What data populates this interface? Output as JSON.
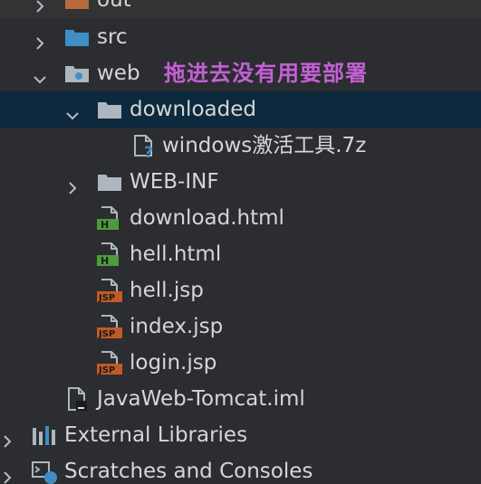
{
  "tree": {
    "rows": [
      {
        "label": "out"
      },
      {
        "label": "src"
      },
      {
        "label": "web",
        "annotation": "拖进去没有用要部署"
      },
      {
        "label": "downloaded"
      },
      {
        "label": "windows激活工具.7z"
      },
      {
        "label": "WEB-INF"
      },
      {
        "label": "download.html"
      },
      {
        "label": "hell.html"
      },
      {
        "label": "hell.jsp"
      },
      {
        "label": "index.jsp"
      },
      {
        "label": "login.jsp"
      },
      {
        "label": "JavaWeb-Tomcat.iml"
      },
      {
        "label": "External Libraries"
      },
      {
        "label": "Scratches and Consoles"
      }
    ]
  },
  "icons": {
    "folder": "folder-icon",
    "web_folder": "web-folder-icon",
    "unknown_file": "unknown-file-icon",
    "html_file": "html-file-icon",
    "jsp_file": "jsp-file-icon",
    "iml_file": "iml-file-icon",
    "libraries": "libraries-icon",
    "scratches": "scratches-icon"
  },
  "colors": {
    "background": "#2b2d30",
    "selection": "#0d293e",
    "text": "#d6d6d6",
    "annotation": "#c560d7",
    "folder_orange": "#b66a3c",
    "folder_blue": "#3d8fc5",
    "folder_gray": "#aeb6bf",
    "html_badge": "#4e9a3d",
    "jsp_badge": "#c15a25"
  }
}
